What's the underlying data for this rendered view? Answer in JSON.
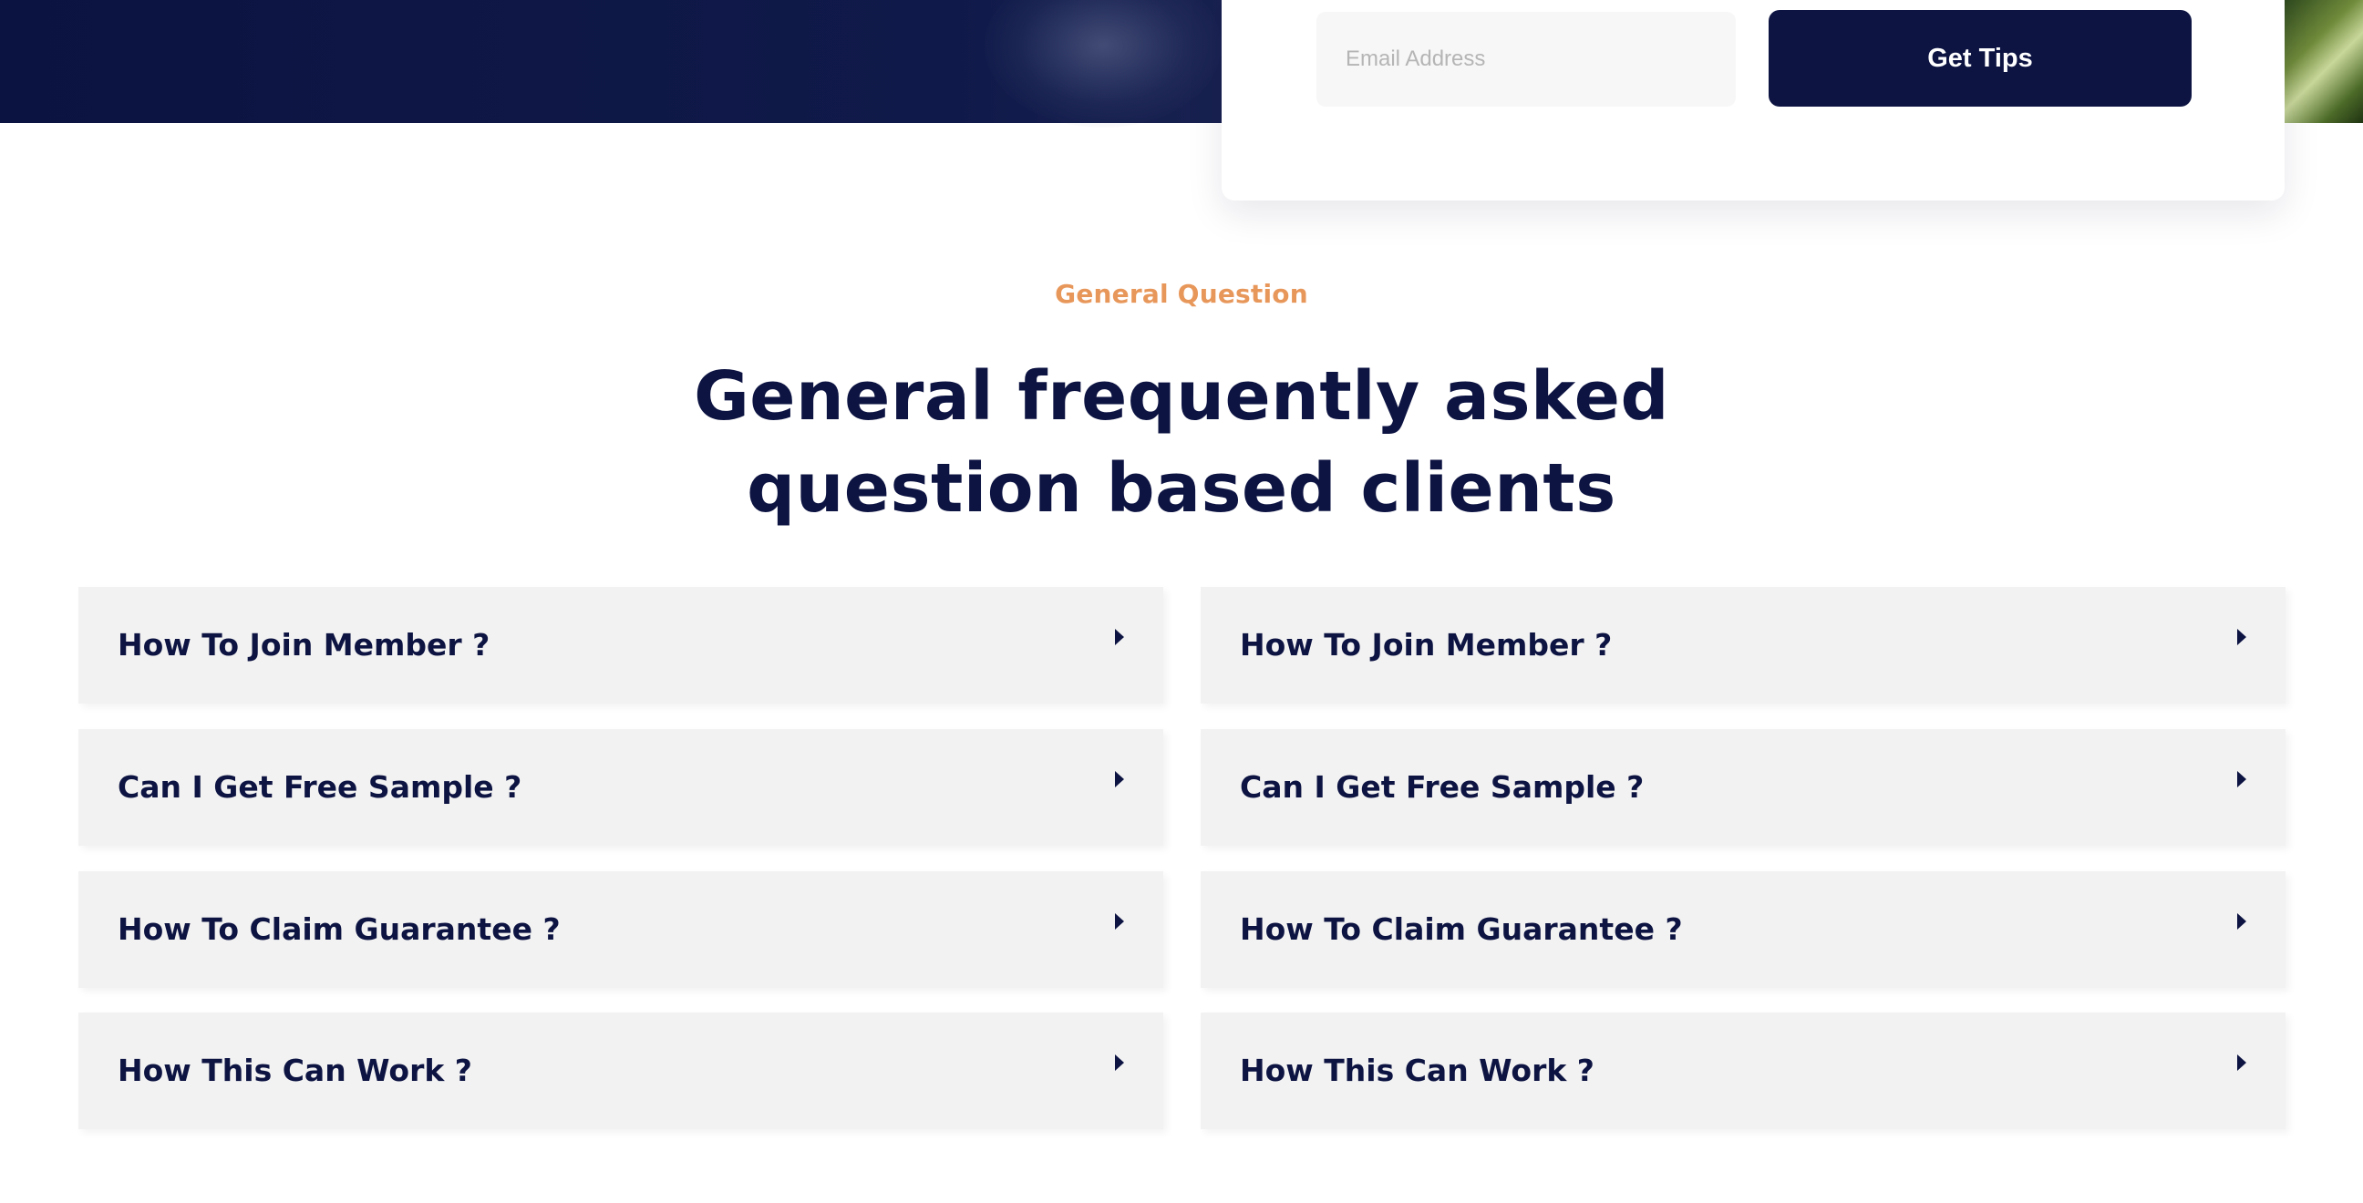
{
  "newsletter": {
    "email_placeholder": "Email Address",
    "submit_label": "Get Tips"
  },
  "faq_section": {
    "eyebrow": "General Question",
    "title_line1": "General frequently asked",
    "title_line2": "question based clients",
    "left_items": [
      {
        "question": "How To Join Member ?",
        "icon": "caret-right-icon"
      },
      {
        "question": "Can I Get Free Sample ?",
        "icon": "caret-right-icon"
      },
      {
        "question": "How To Claim Guarantee ?",
        "icon": "caret-right-icon"
      },
      {
        "question": "How This Can Work ?",
        "icon": "caret-right-icon"
      }
    ],
    "right_items": [
      {
        "question": "How To Join Member ?",
        "icon": "caret-right-icon"
      },
      {
        "question": "Can I Get Free Sample ?",
        "icon": "caret-right-icon"
      },
      {
        "question": "How To Claim Guarantee ?",
        "icon": "caret-right-icon"
      },
      {
        "question": "How This Can Work ?",
        "icon": "caret-right-icon"
      }
    ]
  },
  "colors": {
    "navy": "#0d1442",
    "accent_orange": "#e8975a",
    "faq_background": "#f2f2f2",
    "input_background": "#f7f7f7"
  }
}
